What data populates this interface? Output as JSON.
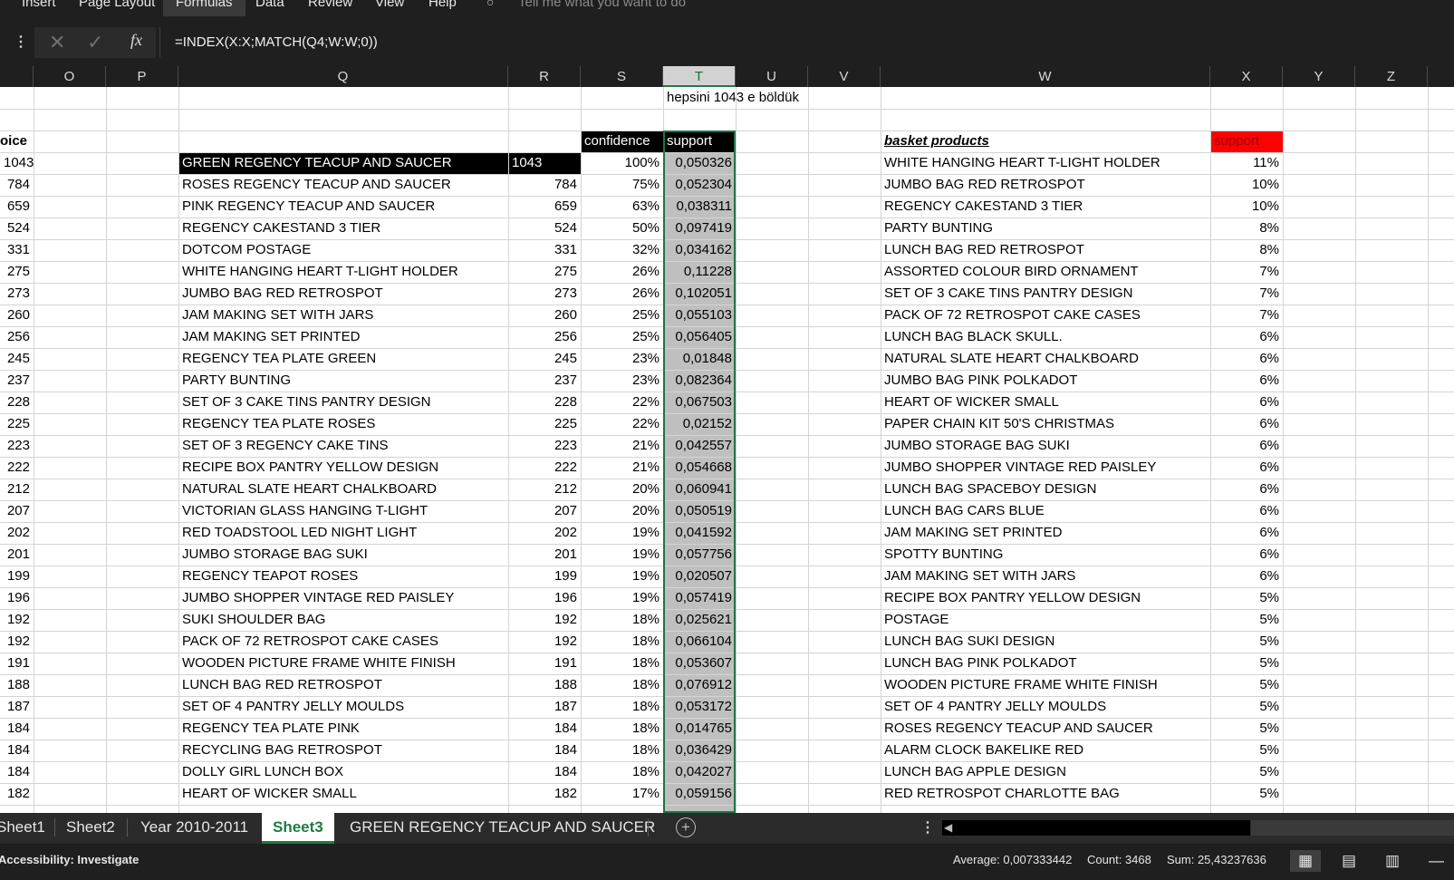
{
  "ribbon": {
    "tabs": [
      "Insert",
      "Page Layout",
      "Formulas",
      "Data",
      "Review",
      "View",
      "Help"
    ],
    "active_tab": "Formulas",
    "tell_me": "Tell me what you want to do"
  },
  "formula_bar": {
    "formula": "=INDEX(X:X;MATCH(Q4;W:W;0))"
  },
  "columns": [
    "O",
    "P",
    "Q",
    "R",
    "S",
    "T",
    "U",
    "V",
    "W",
    "X",
    "Y",
    "Z"
  ],
  "selected_column": "T",
  "sheet": {
    "note": "hepsini 1043 e böldük",
    "o_header": "oice",
    "s_header": "confidence",
    "t_header": "support",
    "w_header": "basket products",
    "x_header": "support",
    "rows": [
      {
        "o": "1043",
        "q": "GREEN REGENCY TEACUP AND SAUCER",
        "r": "1043",
        "s": "100%",
        "t": "0,050326",
        "w": "WHITE HANGING HEART T-LIGHT HOLDER",
        "x": "11%"
      },
      {
        "o": "784",
        "q": "ROSES REGENCY TEACUP AND SAUCER",
        "r": "784",
        "s": "75%",
        "t": "0,052304",
        "w": "JUMBO BAG RED RETROSPOT",
        "x": "10%"
      },
      {
        "o": "659",
        "q": "PINK REGENCY TEACUP AND SAUCER",
        "r": "659",
        "s": "63%",
        "t": "0,038311",
        "w": "REGENCY CAKESTAND 3 TIER",
        "x": "10%"
      },
      {
        "o": "524",
        "q": "REGENCY CAKESTAND 3 TIER",
        "r": "524",
        "s": "50%",
        "t": "0,097419",
        "w": "PARTY BUNTING",
        "x": "8%"
      },
      {
        "o": "331",
        "q": "DOTCOM POSTAGE",
        "r": "331",
        "s": "32%",
        "t": "0,034162",
        "w": "LUNCH BAG RED RETROSPOT",
        "x": "8%"
      },
      {
        "o": "275",
        "q": "WHITE HANGING HEART T-LIGHT HOLDER",
        "r": "275",
        "s": "26%",
        "t": "0,11228",
        "w": "ASSORTED COLOUR BIRD ORNAMENT",
        "x": "7%"
      },
      {
        "o": "273",
        "q": "JUMBO BAG RED RETROSPOT",
        "r": "273",
        "s": "26%",
        "t": "0,102051",
        "w": "SET OF 3 CAKE TINS PANTRY DESIGN",
        "x": "7%"
      },
      {
        "o": "260",
        "q": "JAM MAKING SET WITH JARS",
        "r": "260",
        "s": "25%",
        "t": "0,055103",
        "w": "PACK OF 72 RETROSPOT CAKE CASES",
        "x": "7%"
      },
      {
        "o": "256",
        "q": "JAM MAKING SET PRINTED",
        "r": "256",
        "s": "25%",
        "t": "0,056405",
        "w": "LUNCH BAG  BLACK SKULL.",
        "x": "6%"
      },
      {
        "o": "245",
        "q": "REGENCY TEA PLATE GREEN",
        "r": "245",
        "s": "23%",
        "t": "0,01848",
        "w": "NATURAL SLATE HEART CHALKBOARD",
        "x": "6%"
      },
      {
        "o": "237",
        "q": "PARTY BUNTING",
        "r": "237",
        "s": "23%",
        "t": "0,082364",
        "w": "JUMBO BAG PINK POLKADOT",
        "x": "6%"
      },
      {
        "o": "228",
        "q": "SET OF 3 CAKE TINS PANTRY DESIGN",
        "r": "228",
        "s": "22%",
        "t": "0,067503",
        "w": "HEART OF WICKER SMALL",
        "x": "6%"
      },
      {
        "o": "225",
        "q": "REGENCY TEA PLATE ROSES",
        "r": "225",
        "s": "22%",
        "t": "0,02152",
        "w": "PAPER CHAIN KIT 50'S CHRISTMAS",
        "x": "6%"
      },
      {
        "o": "223",
        "q": "SET OF 3 REGENCY CAKE TINS",
        "r": "223",
        "s": "21%",
        "t": "0,042557",
        "w": "JUMBO STORAGE BAG SUKI",
        "x": "6%"
      },
      {
        "o": "222",
        "q": "RECIPE BOX PANTRY YELLOW DESIGN",
        "r": "222",
        "s": "21%",
        "t": "0,054668",
        "w": "JUMBO SHOPPER VINTAGE RED PAISLEY",
        "x": "6%"
      },
      {
        "o": "212",
        "q": "NATURAL SLATE HEART CHALKBOARD",
        "r": "212",
        "s": "20%",
        "t": "0,060941",
        "w": "LUNCH BAG SPACEBOY DESIGN",
        "x": "6%"
      },
      {
        "o": "207",
        "q": "VICTORIAN GLASS HANGING T-LIGHT",
        "r": "207",
        "s": "20%",
        "t": "0,050519",
        "w": "LUNCH BAG CARS BLUE",
        "x": "6%"
      },
      {
        "o": "202",
        "q": "RED TOADSTOOL LED NIGHT LIGHT",
        "r": "202",
        "s": "19%",
        "t": "0,041592",
        "w": "JAM MAKING SET PRINTED",
        "x": "6%"
      },
      {
        "o": "201",
        "q": "JUMBO STORAGE BAG SUKI",
        "r": "201",
        "s": "19%",
        "t": "0,057756",
        "w": "SPOTTY BUNTING",
        "x": "6%"
      },
      {
        "o": "199",
        "q": "REGENCY TEAPOT ROSES",
        "r": "199",
        "s": "19%",
        "t": "0,020507",
        "w": "JAM MAKING SET WITH JARS",
        "x": "6%"
      },
      {
        "o": "196",
        "q": "JUMBO SHOPPER VINTAGE RED PAISLEY",
        "r": "196",
        "s": "19%",
        "t": "0,057419",
        "w": "RECIPE BOX PANTRY YELLOW DESIGN",
        "x": "5%"
      },
      {
        "o": "192",
        "q": "SUKI  SHOULDER BAG",
        "r": "192",
        "s": "18%",
        "t": "0,025621",
        "w": "POSTAGE",
        "x": "5%"
      },
      {
        "o": "192",
        "q": "PACK OF 72 RETROSPOT CAKE CASES",
        "r": "192",
        "s": "18%",
        "t": "0,066104",
        "w": "LUNCH BAG SUKI DESIGN",
        "x": "5%"
      },
      {
        "o": "191",
        "q": "WOODEN PICTURE FRAME WHITE FINISH",
        "r": "191",
        "s": "18%",
        "t": "0,053607",
        "w": "LUNCH BAG PINK POLKADOT",
        "x": "5%"
      },
      {
        "o": "188",
        "q": "LUNCH BAG RED RETROSPOT",
        "r": "188",
        "s": "18%",
        "t": "0,076912",
        "w": "WOODEN PICTURE FRAME WHITE FINISH",
        "x": "5%"
      },
      {
        "o": "187",
        "q": "SET OF 4 PANTRY JELLY MOULDS",
        "r": "187",
        "s": "18%",
        "t": "0,053172",
        "w": "SET OF 4 PANTRY JELLY MOULDS",
        "x": "5%"
      },
      {
        "o": "184",
        "q": "REGENCY TEA PLATE PINK",
        "r": "184",
        "s": "18%",
        "t": "0,014765",
        "w": "ROSES REGENCY TEACUP AND SAUCER",
        "x": "5%"
      },
      {
        "o": "184",
        "q": "RECYCLING BAG RETROSPOT",
        "r": "184",
        "s": "18%",
        "t": "0,036429",
        "w": "ALARM CLOCK BAKELIKE RED",
        "x": "5%"
      },
      {
        "o": "184",
        "q": "DOLLY GIRL LUNCH BOX",
        "r": "184",
        "s": "18%",
        "t": "0,042027",
        "w": "LUNCH BAG APPLE DESIGN",
        "x": "5%"
      },
      {
        "o": "182",
        "q": "HEART OF WICKER SMALL",
        "r": "182",
        "s": "17%",
        "t": "0,059156",
        "w": "RED RETROSPOT CHARLOTTE BAG",
        "x": "5%"
      }
    ]
  },
  "sheet_tabs": {
    "tabs": [
      "Sheet1",
      "Sheet2",
      "Year 2010-2011",
      "Sheet3",
      "GREEN REGENCY TEACUP AND SAUCER"
    ],
    "active": "Sheet3"
  },
  "status_bar": {
    "accessibility": "Accessibility: Investigate",
    "average": "Average: 0,007333442",
    "count": "Count: 3468",
    "sum": "Sum: 25,43237636"
  },
  "colors": {
    "accent_green": "#217346",
    "header_red": "#ff0000",
    "selection_gray": "#bfbfbf"
  }
}
